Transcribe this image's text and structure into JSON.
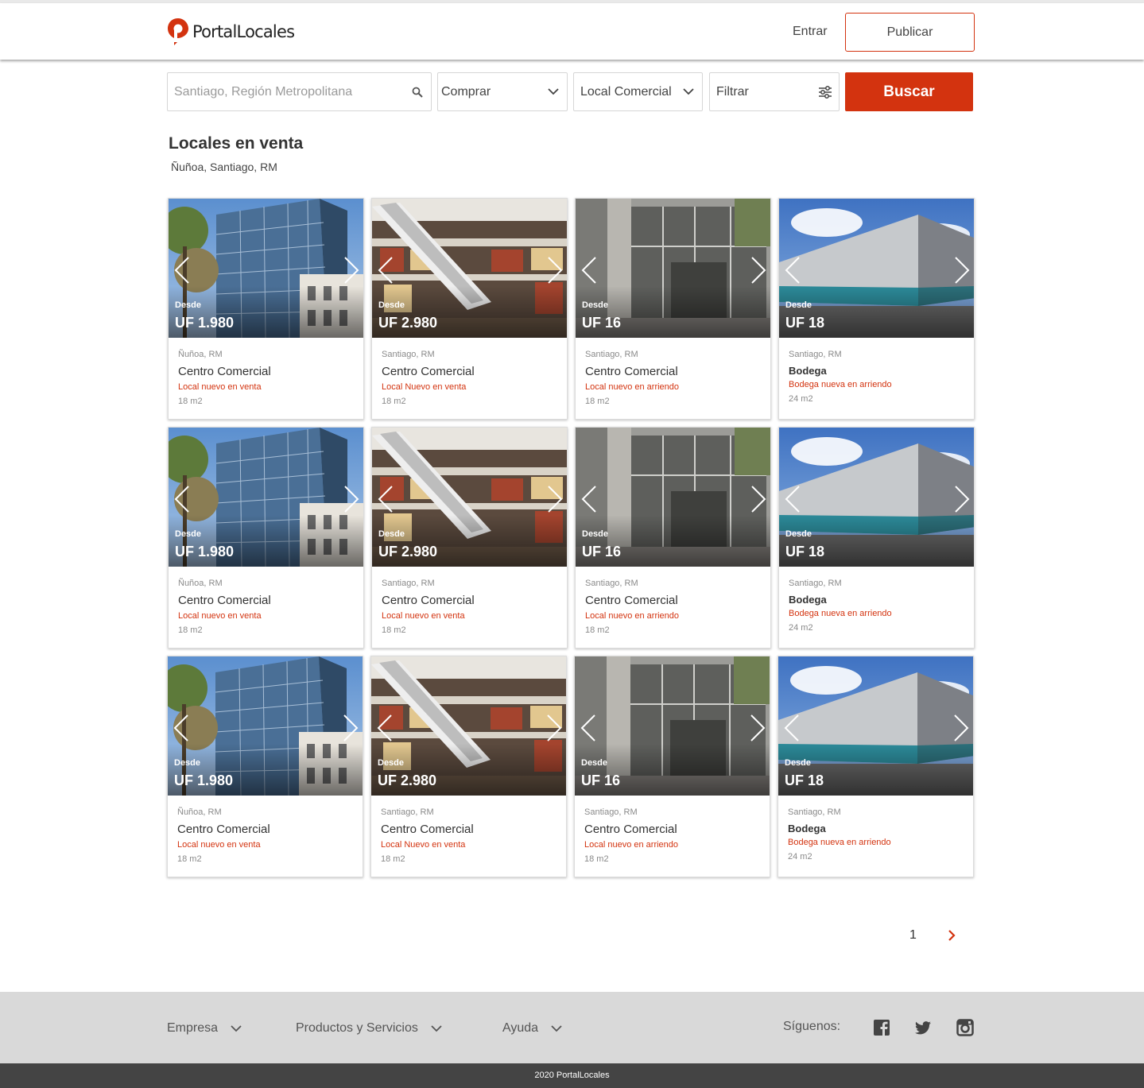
{
  "header": {
    "logo_text": "PortalLocales",
    "login_label": "Entrar",
    "publish_label": "Publicar"
  },
  "search": {
    "location_placeholder": "Santiago, Región Metropolitana",
    "operation": "Comprar",
    "property_type": "Local Comercial",
    "filter_label": "Filtrar",
    "submit_label": "Buscar"
  },
  "results": {
    "title": "Locales en venta",
    "subtitle": "Ñuñoa, Santiago, RM"
  },
  "listing_template": [
    {
      "image": "glass-building",
      "from_label": "Desde",
      "price": "UF 1.980",
      "location": "Ñuñoa, RM",
      "title": "Centro Comercial",
      "description": "Local nuevo en venta",
      "size": "18 m2"
    },
    {
      "image": "mall-escalator",
      "from_label": "Desde",
      "price": "UF 2.980",
      "location": "Santiago, RM",
      "title": "Centro Comercial",
      "description": "Local Nuevo en venta",
      "size": "18 m2"
    },
    {
      "image": "glass-storefront",
      "from_label": "Desde",
      "price": "UF 16",
      "location": "Santiago, RM",
      "title": "Centro Comercial",
      "description": "Local nuevo en arriendo",
      "size": "18 m2"
    },
    {
      "image": "warehouse",
      "from_label": "Desde",
      "price": "UF 18",
      "location": "Santiago, RM",
      "title": "Bodega",
      "description": "Bodega nueva en arriendo",
      "size": "24 m2"
    }
  ],
  "listings": [
    {
      "image": "glass-building",
      "from_label": "Desde",
      "price": "UF 1.980",
      "location": "Ñuñoa, RM",
      "title": "Centro Comercial",
      "description": "Local nuevo en venta",
      "size": "18 m2"
    },
    {
      "image": "mall-escalator",
      "from_label": "Desde",
      "price": "UF 2.980",
      "location": "Santiago, RM",
      "title": "Centro Comercial",
      "description": "Local Nuevo en venta",
      "size": "18 m2"
    },
    {
      "image": "glass-storefront",
      "from_label": "Desde",
      "price": "UF 16",
      "location": "Santiago, RM",
      "title": "Centro Comercial",
      "description": "Local nuevo en arriendo",
      "size": "18 m2"
    },
    {
      "image": "warehouse",
      "from_label": "Desde",
      "price": "UF 18",
      "location": "Santiago, RM",
      "title": "Bodega",
      "description": "Bodega nueva en arriendo",
      "size": "24 m2"
    },
    {
      "image": "glass-building",
      "from_label": "Desde",
      "price": "UF 1.980",
      "location": "Ñuñoa, RM",
      "title": "Centro Comercial",
      "description": "Local nuevo en venta",
      "size": "18 m2"
    },
    {
      "image": "mall-escalator",
      "from_label": "Desde",
      "price": "UF 2.980",
      "location": "Santiago, RM",
      "title": "Centro Comercial",
      "description": "Local nuevo en venta",
      "size": "18 m2"
    },
    {
      "image": "glass-storefront",
      "from_label": "Desde",
      "price": "UF 16",
      "location": "Santiago, RM",
      "title": "Centro Comercial",
      "description": "Local nuevo en arriendo",
      "size": "18 m2"
    },
    {
      "image": "warehouse",
      "from_label": "Desde",
      "price": "UF 18",
      "location": "Santiago, RM",
      "title": "Bodega",
      "description": "Bodega nueva en arriendo",
      "size": "24 m2"
    },
    {
      "image": "glass-building",
      "from_label": "Desde",
      "price": "UF 1.980",
      "location": "Ñuñoa, RM",
      "title": "Centro Comercial",
      "description": "Local nuevo en venta",
      "size": "18 m2"
    },
    {
      "image": "mall-escalator",
      "from_label": "Desde",
      "price": "UF 2.980",
      "location": "Santiago, RM",
      "title": "Centro Comercial",
      "description": "Local Nuevo en venta",
      "size": "18 m2"
    },
    {
      "image": "glass-storefront",
      "from_label": "Desde",
      "price": "UF 16",
      "location": "Santiago, RM",
      "title": "Centro Comercial",
      "description": "Local nuevo en arriendo",
      "size": "18 m2"
    },
    {
      "image": "warehouse",
      "from_label": "Desde",
      "price": "UF 18",
      "location": "Santiago, RM",
      "title": "Bodega",
      "description": "Bodega nueva en arriendo",
      "size": "24 m2"
    }
  ],
  "pagination": {
    "current_page": "1"
  },
  "footer": {
    "nav": [
      "Empresa",
      "Productos y Servicios",
      "Ayuda"
    ],
    "follow_label": "Síguenos:",
    "social_icons": [
      "facebook-icon",
      "twitter-icon",
      "instagram-icon"
    ],
    "copyright": "2020 PortalLocales"
  },
  "colors": {
    "accent": "#d3330f",
    "footer_bg": "#d9d9d9",
    "bottom_bar": "#444444"
  }
}
